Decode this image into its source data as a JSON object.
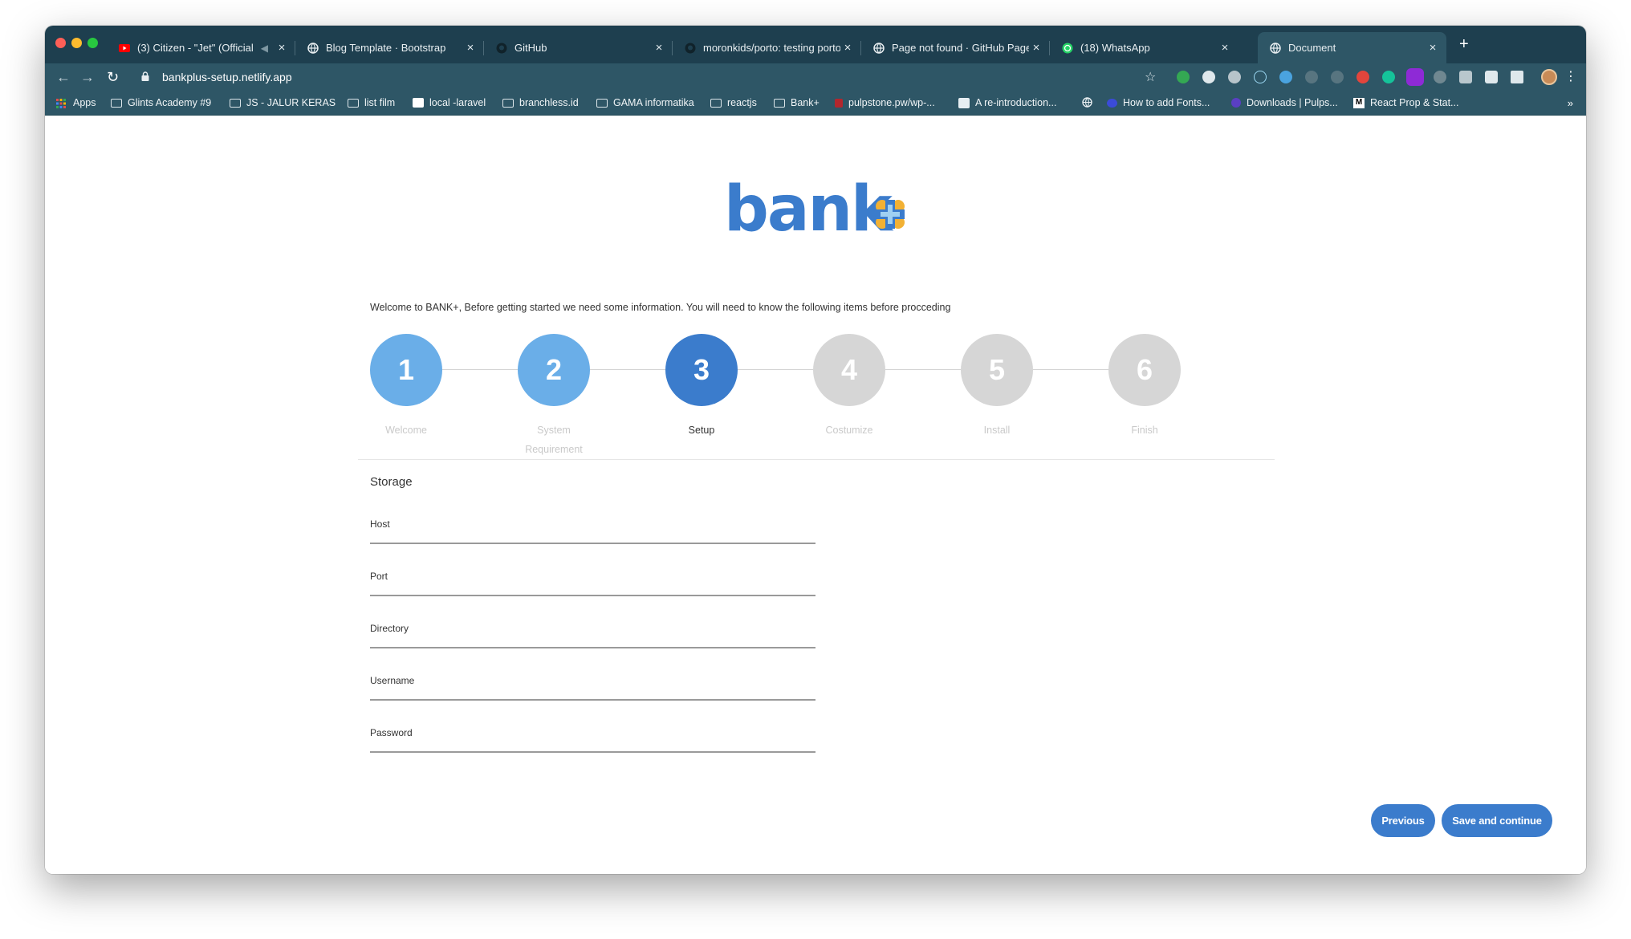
{
  "browser": {
    "tabs": [
      {
        "title": "(3) Citizen - \"Jet\" (Official",
        "icon": "youtube-icon",
        "audio": true
      },
      {
        "title": "Blog Template · Bootstrap",
        "icon": "globe-icon"
      },
      {
        "title": "GitHub",
        "icon": "github-icon"
      },
      {
        "title": "moronkids/porto: testing porto",
        "icon": "github-icon"
      },
      {
        "title": "Page not found · GitHub Pages",
        "icon": "globe-icon"
      },
      {
        "title": "(18) WhatsApp",
        "icon": "whatsapp-icon"
      },
      {
        "title": "Document",
        "icon": "globe-icon",
        "active": true
      }
    ],
    "tab_close": "×",
    "new_tab": "+",
    "url": "bankplus-setup.netlify.app",
    "bookmarks": [
      {
        "label": "Apps",
        "icon": "apps-grid-icon"
      },
      {
        "label": "Glints Academy #9",
        "icon": "folder-icon"
      },
      {
        "label": "JS - JALUR KERAS",
        "icon": "folder-icon"
      },
      {
        "label": "list film",
        "icon": "folder-icon"
      },
      {
        "label": "local -laravel",
        "icon": "page-icon"
      },
      {
        "label": "branchless.id",
        "icon": "folder-icon"
      },
      {
        "label": "GAMA informatika",
        "icon": "folder-icon"
      },
      {
        "label": "reactjs",
        "icon": "folder-icon"
      },
      {
        "label": "Bank+",
        "icon": "folder-icon"
      },
      {
        "label": "pulpstone.pw/wp-...",
        "icon": "site-icon"
      },
      {
        "label": "A re-introduction...",
        "icon": "site-icon"
      },
      {
        "label": "",
        "icon": "globe-icon"
      },
      {
        "label": "How to add Fonts...",
        "icon": "site-icon"
      },
      {
        "label": "Downloads | Pulps...",
        "icon": "site-icon"
      },
      {
        "label": "React Prop & Stat...",
        "icon": "medium-icon"
      }
    ],
    "more_bookmarks": "»",
    "colors": {
      "tabstrip": "#1e3f4f",
      "toolbar": "#2e5666"
    }
  },
  "page": {
    "logo_text": "bank",
    "intro": "Welcome to BANK+, Before getting started we need some information. You will need to know the following items before procceding",
    "steps": [
      {
        "number": "1",
        "label": "Welcome",
        "state": "done"
      },
      {
        "number": "2",
        "label": "System Requirement",
        "state": "done"
      },
      {
        "number": "3",
        "label": "Setup",
        "state": "active"
      },
      {
        "number": "4",
        "label": "Costumize",
        "state": "pending"
      },
      {
        "number": "5",
        "label": "Install",
        "state": "pending"
      },
      {
        "number": "6",
        "label": "Finish",
        "state": "pending"
      }
    ],
    "section_title": "Storage",
    "fields": [
      {
        "label": "Host",
        "value": ""
      },
      {
        "label": "Port",
        "value": ""
      },
      {
        "label": "Directory",
        "value": ""
      },
      {
        "label": "Username",
        "value": ""
      },
      {
        "label": "Password",
        "value": ""
      }
    ],
    "buttons": {
      "previous": "Previous",
      "save": "Save and continue"
    },
    "colors": {
      "done": "#6aaee8",
      "active": "#3b7ccc",
      "pending": "#d6d6d6",
      "accent": "#3b7ccc"
    }
  }
}
